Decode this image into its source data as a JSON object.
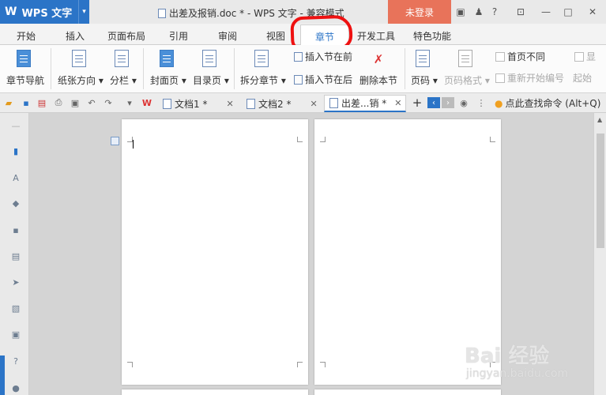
{
  "app": {
    "logo": "W",
    "name": "WPS 文字",
    "document_title": "出差及报销.doc * - WPS 文字 - 兼容模式",
    "login_button": "未登录"
  },
  "menu_tabs": [
    "开始",
    "插入",
    "页面布局",
    "引用",
    "审阅",
    "视图",
    "章节",
    "开发工具",
    "特色功能"
  ],
  "active_tab": "章节",
  "ribbon": {
    "chapter_nav": "章节导航",
    "paper_orientation": "纸张方向",
    "columns": "分栏",
    "cover_page": "封面页",
    "toc_page": "目录页",
    "split_chapter": "拆分章节",
    "insert_section_before": "插入节在前",
    "insert_section_after": "插入节在后",
    "delete_section": "删除本节",
    "page_number": "页码",
    "page_number_format": "页码格式",
    "different_first_page": "首页不同",
    "restart_numbering": "重新开始编号",
    "show_cut": "显",
    "start_cut": "起始"
  },
  "doc_tabs": [
    {
      "label": "文档1 *",
      "close": "✕"
    },
    {
      "label": "文档2 *",
      "close": "✕"
    },
    {
      "label": "出差...销 *",
      "close": "✕"
    }
  ],
  "active_doc_tab": "出差...销 *",
  "find_command": "点此查找命令 (Alt+Q)",
  "new_tab": "+",
  "watermark": {
    "main": "Bai 经验",
    "sub": "jingyan.baidu.com"
  },
  "colors": {
    "accent": "#2b74c7",
    "login": "#e8735a",
    "annotation": "#ee1111"
  }
}
